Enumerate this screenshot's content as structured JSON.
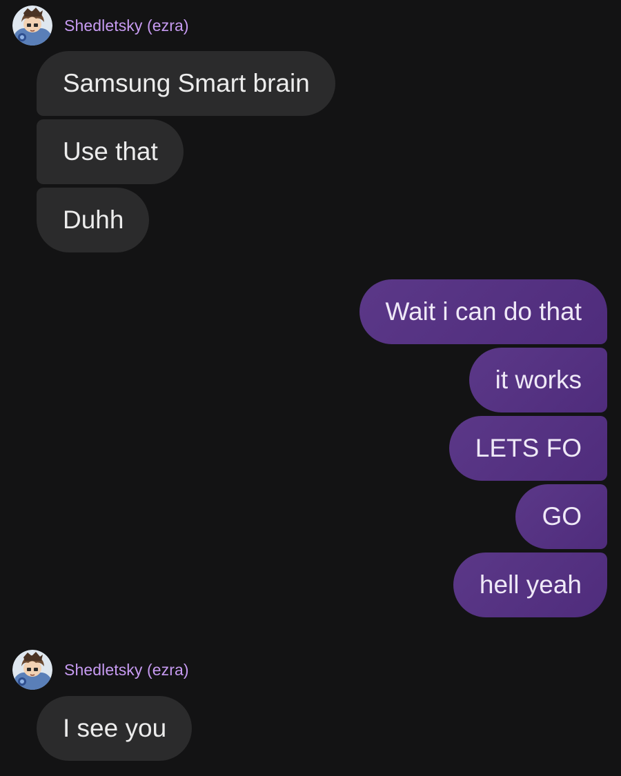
{
  "conversation": {
    "groups": [
      {
        "sender": "Shedletsky (ezra)",
        "avatar_icon": "user-avatar-icon",
        "messages": [
          "Samsung Smart brain",
          "Use that",
          "Duhh"
        ]
      },
      {
        "sender": "",
        "messages": [
          "Wait i can do that",
          "it works",
          "LETS FO",
          "GO",
          "hell yeah"
        ]
      },
      {
        "sender": "Shedletsky (ezra)",
        "avatar_icon": "user-avatar-icon",
        "messages": [
          "I see you"
        ]
      }
    ]
  },
  "colors": {
    "background": "#131314",
    "incoming_bubble": "#2b2b2c",
    "outgoing_bubble": "#552f83",
    "sender_name": "#c79bf2"
  }
}
